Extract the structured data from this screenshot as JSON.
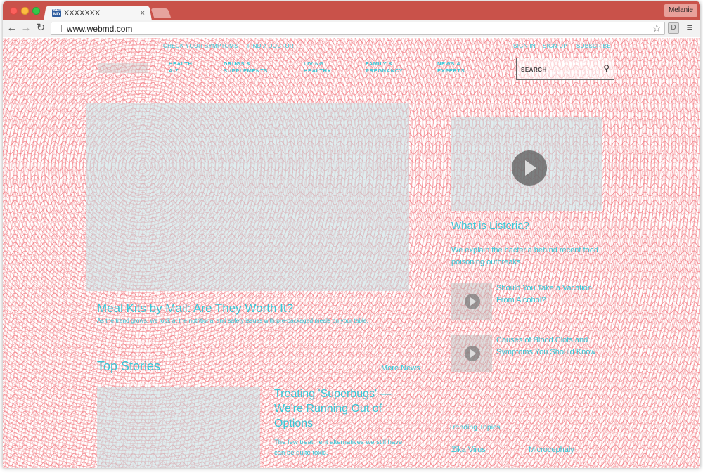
{
  "browser": {
    "tab_title": "XXXXXXX",
    "tab_close": "×",
    "favicon_text": "Web MD",
    "profile_name": "Melanie",
    "url": "www.webmd.com",
    "back_icon": "←",
    "forward_icon": "→",
    "reload_icon": "↻",
    "star_icon": "☆",
    "extension_label": "D",
    "menu_icon": "≡"
  },
  "header": {
    "utility_left": [
      "CHECK YOUR SYMPTOMS",
      "FIND A DOCTOR"
    ],
    "utility_right": [
      "SIGN IN",
      "SIGN UP",
      "SUBSCRIBE"
    ],
    "nav": [
      {
        "line1": "HEALTH",
        "line2": "A-Z"
      },
      {
        "line1": "DRUGS &",
        "line2": "SUPPLEMENTS"
      },
      {
        "line1": "LIVING",
        "line2": "HEALTHY"
      },
      {
        "line1": "FAMILY &",
        "line2": "PREGNANCY"
      },
      {
        "line1": "NEWS &",
        "line2": "EXPERTS"
      }
    ],
    "search_placeholder": "SEARCH"
  },
  "hero": {
    "title": "Meal Kits by Mail: Are They Worth It?",
    "subtitle": "As the trend grows, we look at the nutritional and safety issues with pre-packaged meals on your table."
  },
  "video": {
    "title": "What is Listeria?",
    "description": "We explain the bacteria behind recent food poisoning outbreaks."
  },
  "side_links": [
    "Should You Take a Vacation From Alcohol?",
    "Causes of Blood Clots and Symptoms You Should Know"
  ],
  "top_stories": {
    "heading": "Top Stories",
    "more": "More News",
    "story_title": "Treating 'Superbugs' — We're Running Out of Options",
    "story_desc": "The few treatment alternatives we still have can be quite toxic."
  },
  "trending": {
    "heading": "Trending Topics",
    "items": [
      "Zika Virus",
      "Microcephaly"
    ]
  },
  "colors": {
    "accent": "#38c8d8",
    "pattern": "#f4737a",
    "titlebar": "#c9524a"
  }
}
